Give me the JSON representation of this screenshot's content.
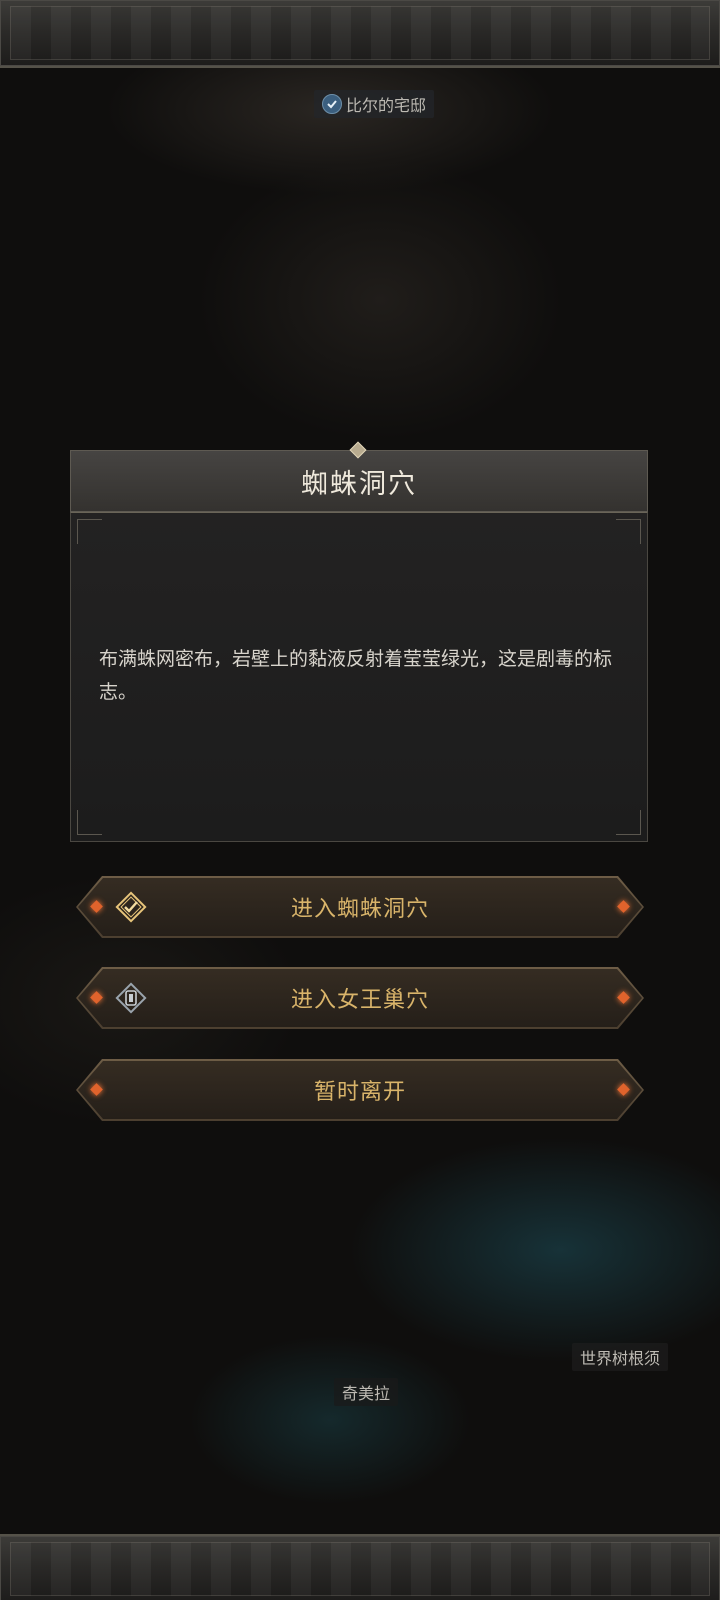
{
  "map": {
    "location_residence": "比尔的宅邸",
    "location_world_tree": "世界树根须",
    "location_chimera": "奇美拉"
  },
  "dialog": {
    "title": "蜘蛛洞穴",
    "description": "布满蛛网密布，岩壁上的黏液反射着莹莹绿光，这是剧毒的标志。"
  },
  "options": [
    {
      "label": "进入蜘蛛洞穴",
      "icon": "diamond-check-icon"
    },
    {
      "label": "进入女王巢穴",
      "icon": "diamond-gate-icon"
    },
    {
      "label": "暂时离开",
      "icon": ""
    }
  ],
  "colors": {
    "option_text": "#d9b46a",
    "gem": "#e0632c",
    "title_text": "#efe9dc"
  }
}
